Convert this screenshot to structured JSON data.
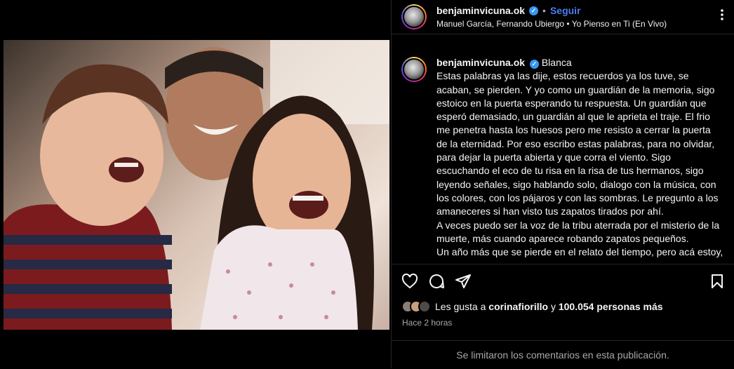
{
  "post": {
    "username": "benjaminvicuna.ok",
    "verified_mark": "✓",
    "separator": "•",
    "follow_label": "Seguir",
    "audio": "Manuel García, Fernando Ubiergo • Yo Pienso en Ti (En Vivo)",
    "more_icon": "more-horizontal-icon",
    "more_label": "⋮"
  },
  "caption": {
    "username": "benjaminvicuna.ok",
    "verified_mark": "✓",
    "text": "Blanca\nEstas palabras ya las dije, estos recuerdos ya los tuve, se acaban, se pierden. Y yo como un guardián de la memoria, sigo estoico en la puerta esperando tu respuesta. Un guardián que esperó demasiado, un guardián al que le aprieta el traje. El frio me penetra hasta los huesos pero me resisto a cerrar la puerta de la eternidad. Por eso escribo estas palabras, para no olvidar, para dejar la puerta abierta y que corra el viento. Sigo escuchando el eco de tu risa en la risa de tus hermanos, sigo leyendo señales, sigo hablando solo, dialogo con la música, con los colores, con los pájaros y con las sombras. Le pregunto a los amaneceres si han visto tus zapatos tirados por ahí.\nA veces puedo ser la voz de la tribu aterrada por el misterio de la muerte, más cuando aparece robando zapatos pequeños.\nUn año más que se pierde en el relato del tiempo, pero acá estoy, más viejo y más fuerte, honrando tu nombre, tu nobleza y la alegría"
  },
  "actions": {
    "icons": [
      "heart-icon",
      "comment-icon",
      "share-icon",
      "bookmark-icon"
    ]
  },
  "likes": {
    "prefix": "Les gusta a",
    "user": "corinafiorillo",
    "connector": "y",
    "count": "100.054 personas más"
  },
  "timestamp": "Hace 2 horas",
  "comments_notice": "Se limitaron los comentarios en esta publicación.",
  "media": {
    "mute_icon": "muted-speaker-icon"
  },
  "colors": {
    "follow": "#4c7df0",
    "verified": "#3897f0",
    "background": "#000000",
    "secondary_text": "#a8a8a8"
  }
}
